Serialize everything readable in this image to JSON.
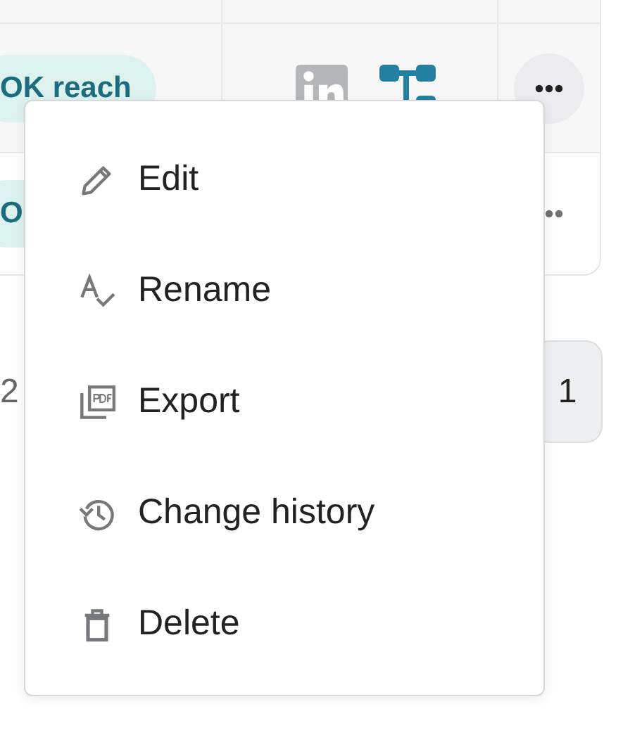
{
  "table": {
    "rows": [
      {
        "tag": "OK reach",
        "highlighted": true
      },
      {
        "tag": "O",
        "highlighted": false
      }
    ]
  },
  "pagination": {
    "left_text": "2",
    "page_button": "1"
  },
  "menu": {
    "items": [
      {
        "label": "Edit"
      },
      {
        "label": "Rename"
      },
      {
        "label": "Export"
      },
      {
        "label": "Change history"
      },
      {
        "label": "Delete"
      }
    ]
  }
}
